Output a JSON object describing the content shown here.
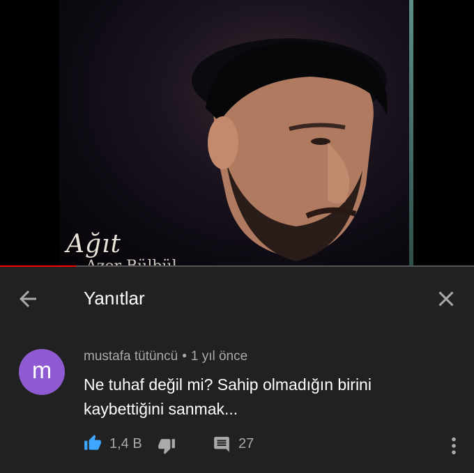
{
  "video": {
    "album_title": "Ağıt",
    "album_subtitle": "Azer Bülbül",
    "progress": 0.16,
    "progress_color": "#ff0000"
  },
  "header": {
    "title": "Yanıtlar",
    "back_icon": "arrow-left-icon",
    "close_icon": "close-icon"
  },
  "comment": {
    "avatar_letter": "m",
    "avatar_color": "#8e5bd3",
    "author": "mustafa tütüncü",
    "separator": "•",
    "time": "1 yıl önce",
    "text": "Ne tuhaf değil mi? Sahip olmadığın birini kaybettiğini sanmak...",
    "likes": "1,4 B",
    "replies": "27",
    "like_color": "#3ea6ff"
  }
}
